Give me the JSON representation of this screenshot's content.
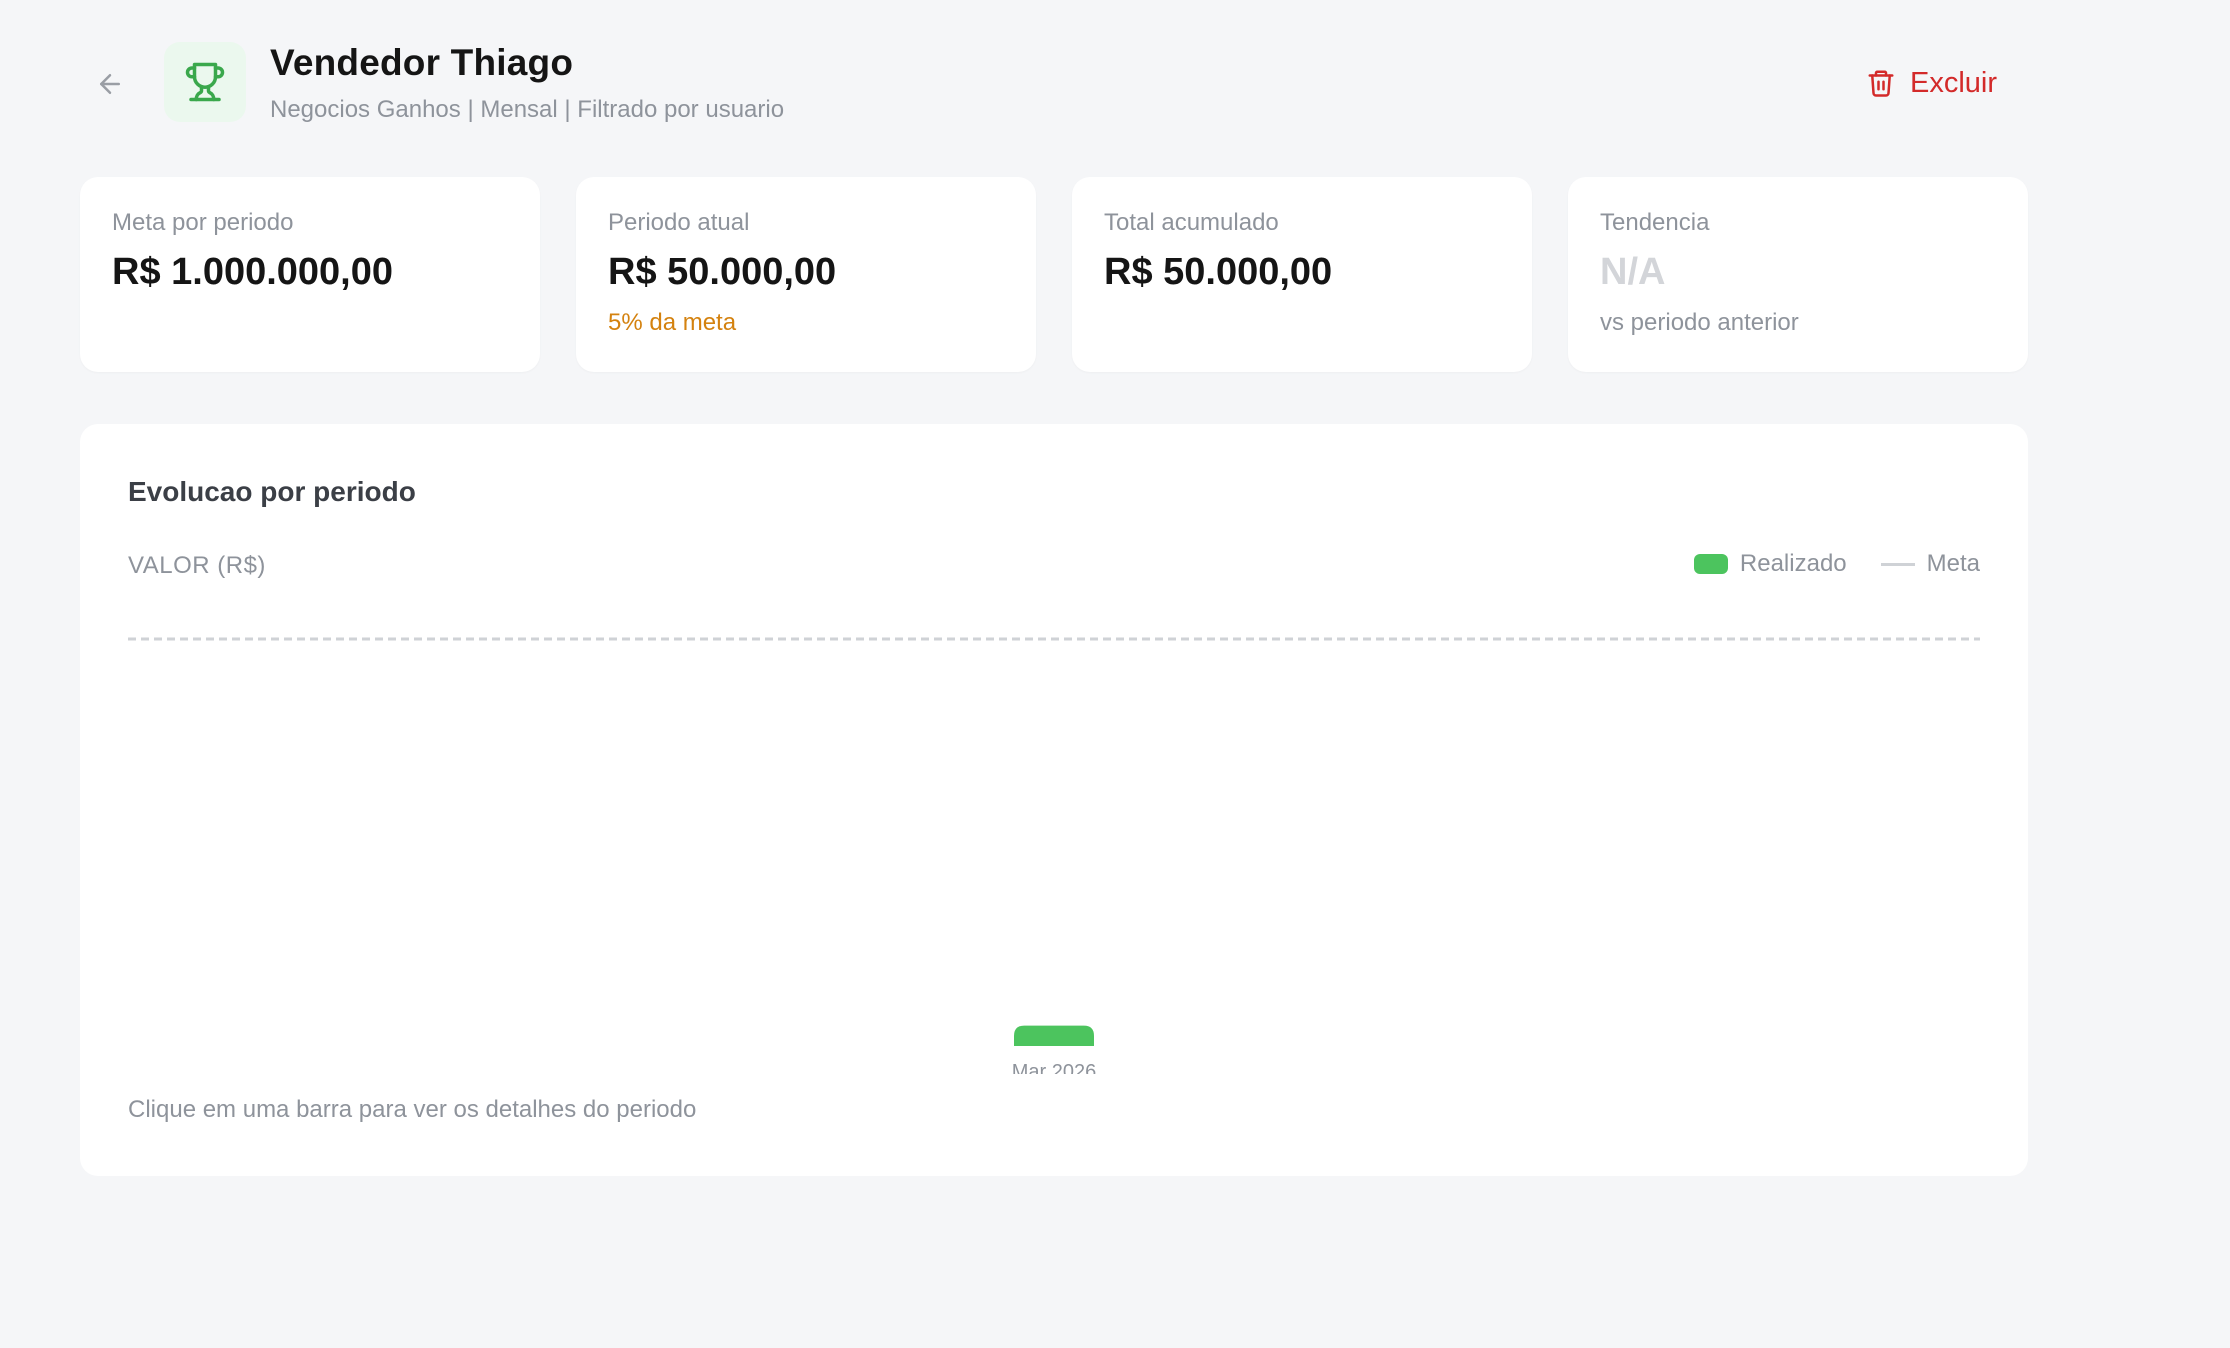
{
  "header": {
    "title": "Vendedor Thiago",
    "subtitle": "Negocios Ganhos | Mensal | Filtrado por usuario",
    "delete_label": "Excluir"
  },
  "cards": [
    {
      "label": "Meta por periodo",
      "value": "R$ 1.000.000,00",
      "note": ""
    },
    {
      "label": "Periodo atual",
      "value": "R$ 50.000,00",
      "note": "5% da meta"
    },
    {
      "label": "Total acumulado",
      "value": "R$ 50.000,00",
      "note": ""
    },
    {
      "label": "Tendencia",
      "value": "N/A",
      "note": "vs periodo anterior"
    }
  ],
  "panel": {
    "title": "Evolucao por periodo",
    "hint": "Clique em uma barra para ver os detalhes do periodo"
  },
  "colors": {
    "accent_green": "#4cc45e",
    "danger_red": "#d32a2a",
    "warning_orange": "#d4820f",
    "meta_line": "#cfd2d6"
  },
  "icons": {
    "back": "arrow-left-icon",
    "trophy": "trophy-icon",
    "delete": "trash-icon"
  },
  "chart_data": {
    "type": "bar",
    "ylabel": "VALOR (R$)",
    "categories": [
      "Mar 2026"
    ],
    "series": [
      {
        "name": "Realizado",
        "values": [
          50000
        ]
      }
    ],
    "target_line": {
      "name": "Meta",
      "value": 1000000,
      "style": "dashed"
    },
    "ylim": [
      0,
      1000000
    ],
    "legend": "top-right",
    "grid": false
  }
}
